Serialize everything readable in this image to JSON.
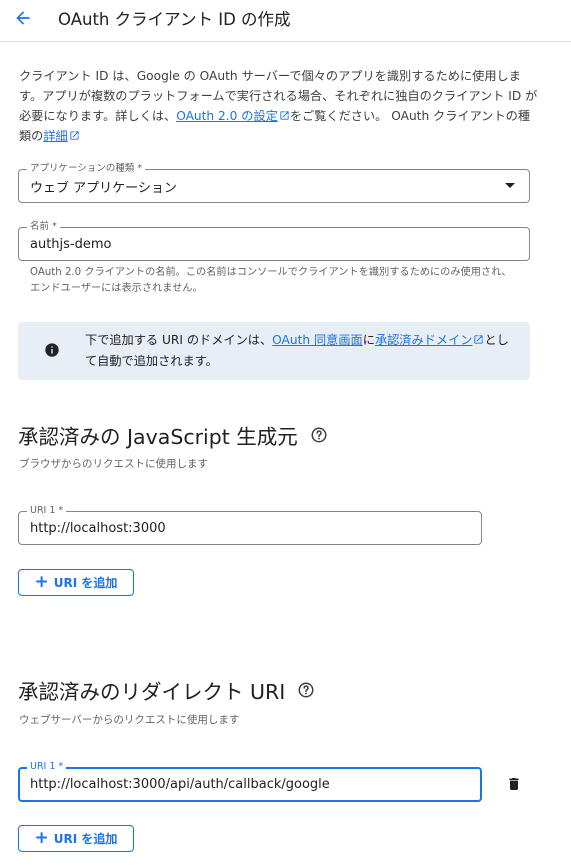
{
  "header": {
    "back_icon": "arrow-back-icon",
    "title": "OAuth クライアント ID の作成"
  },
  "intro": {
    "text_1": "クライアント ID は、Google の OAuth サーバーで個々のアプリを識別するために使用します。アプリが複数のプラットフォームで実行される場合、それぞれに独自のクライアント ID が必要になります。詳しくは、",
    "link_oauth_settings": "OAuth 2.0 の設定",
    "text_2": "をご覧ください。 OAuth クライアントの種類の",
    "link_details": "詳細"
  },
  "app_type": {
    "label": "アプリケーションの種類 *",
    "value": "ウェブ アプリケーション"
  },
  "name_field": {
    "label": "名前 *",
    "value": "authjs-demo",
    "hint": "OAuth 2.0 クライアントの名前。この名前はコンソールでクライアントを識別するためにのみ使用され、エンドユーザーには表示されません。"
  },
  "banner": {
    "icon": "info-icon",
    "text_1": "下で追加する URI のドメインは、",
    "link_consent": "OAuth 同意画面",
    "text_2": "に",
    "link_domains": "承認済みドメイン",
    "text_3": "として自動で追加されます。"
  },
  "js_origins": {
    "title": "承認済みの JavaScript 生成元",
    "subtitle": "ブラウザからのリクエストに使用します",
    "uri_label": "URI 1 *",
    "uri_value": "http://localhost:3000",
    "add_label": "URI を追加"
  },
  "redirect_uris": {
    "title": "承認済みのリダイレクト URI",
    "subtitle": "ウェブサーバーからのリクエストに使用します",
    "uri_label": "URI 1 *",
    "uri_value": "http://localhost:3000/api/auth/callback/google",
    "add_label": "URI を追加"
  },
  "colors": {
    "accent": "#1a73e8",
    "banner_bg": "#e8eef5",
    "border": "#80868b"
  }
}
